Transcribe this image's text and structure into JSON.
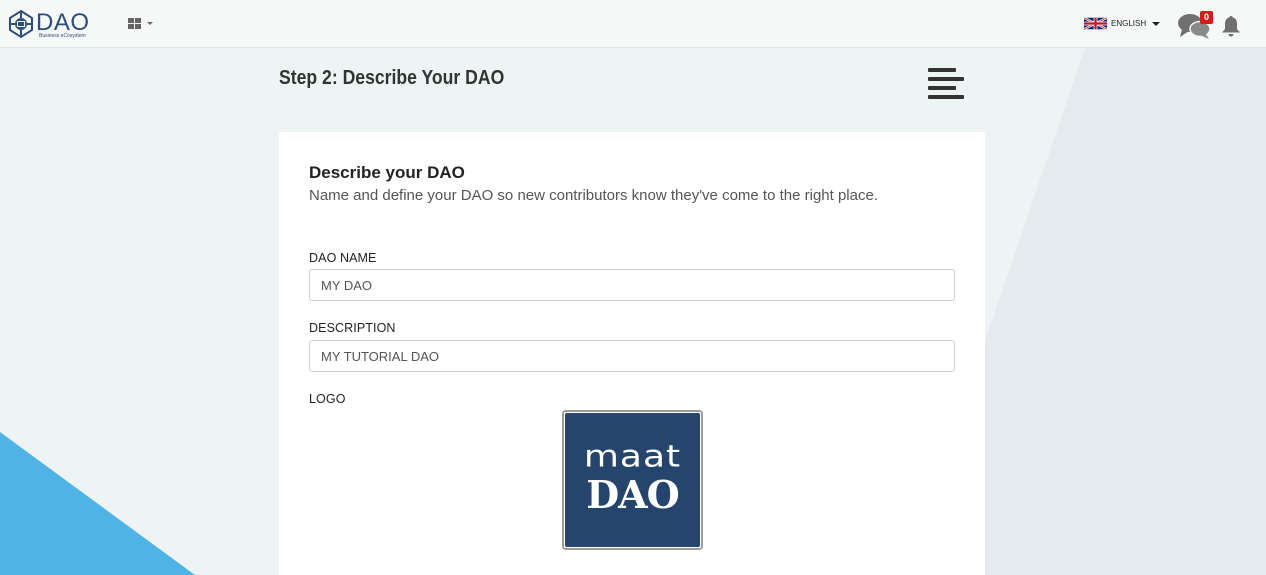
{
  "brand": {
    "name": "DAO",
    "tagline": "Business eCosystem"
  },
  "topbar": {
    "language": "ENGLISH",
    "chat_badge": "0"
  },
  "page": {
    "step_title": "Step 2: Describe Your DAO"
  },
  "card": {
    "title": "Describe your DAO",
    "subtitle": "Name and define your DAO so new contributors know they've come to the right place.",
    "fields": {
      "name_label": "DAO NAME",
      "name_value": "MY DAO",
      "description_label": "DESCRIPTION",
      "description_value": "MY TUTORIAL DAO",
      "logo_label": "LOGO"
    },
    "logo": {
      "line1": "maat",
      "line2": "DAO"
    }
  },
  "colors": {
    "accent_blue": "#4fb3e6",
    "logo_bg": "#26456d",
    "badge_red": "#d71c1c"
  }
}
